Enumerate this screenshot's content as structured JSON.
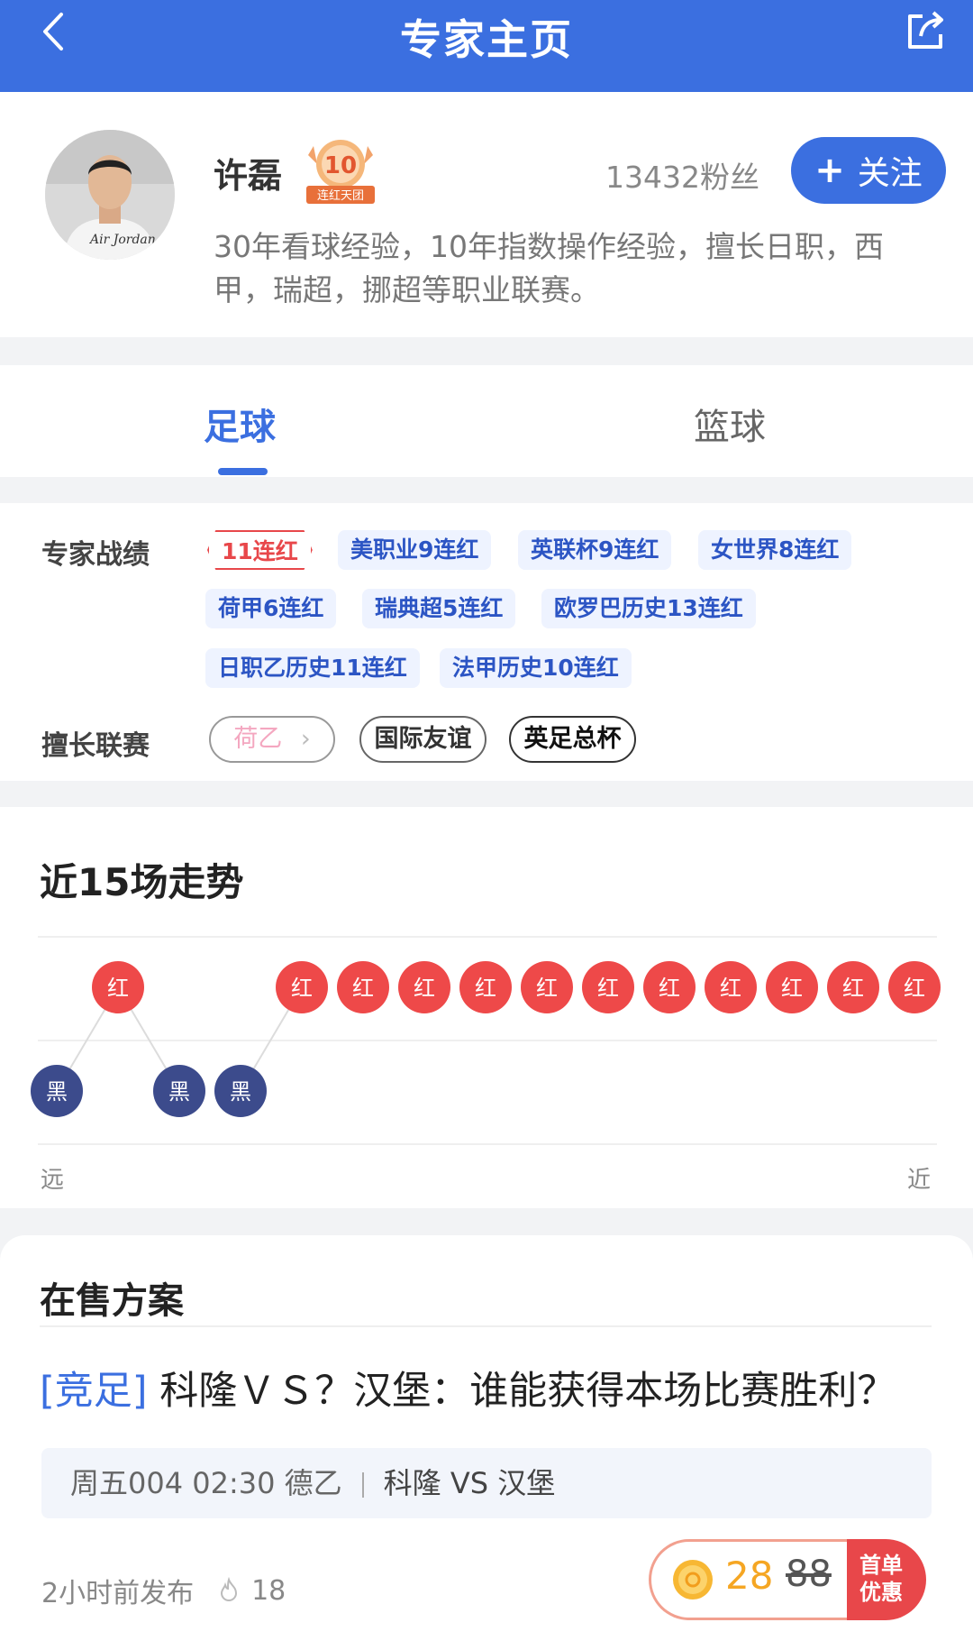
{
  "header": {
    "title": "专家主页"
  },
  "profile": {
    "name": "许磊",
    "badge_number": "10",
    "badge_text": "连红天团",
    "fans": "13432粉丝",
    "follow_label": "关注",
    "bio": "30年看球经验，10年指数操作经验，擅长日职，西甲，瑞超，挪超等职业联赛。"
  },
  "tabs": {
    "active": "足球",
    "inactive": "篮球"
  },
  "record": {
    "label": "专家战绩",
    "highlight": "11连红",
    "tags": [
      "美职业9连红",
      "英联杯9连红",
      "女世界8连红",
      "荷甲6连红",
      "瑞典超5连红",
      "欧罗巴历史13连红",
      "日职乙历史11连红",
      "法甲历史10连红"
    ],
    "league_label": "擅长联赛",
    "leagues": [
      "荷乙",
      "国际友谊",
      "英足总杯"
    ]
  },
  "trend": {
    "title": "近15场走势",
    "results": [
      "黑",
      "红",
      "黑",
      "黑",
      "红",
      "红",
      "红",
      "红",
      "红",
      "红",
      "红",
      "红",
      "红",
      "红",
      "红"
    ],
    "far_label": "远",
    "near_label": "近",
    "colors": {
      "red": "#ee4949",
      "black": "#3c4b8c"
    }
  },
  "sale": {
    "title": "在售方案",
    "plan_category": "[竞足]",
    "plan_title": " 科隆ＶＳ？汉堡：谁能获得本场比赛胜利？",
    "match_info": "周五004 02:30 德乙",
    "match_teams": "科隆 VS 汉堡",
    "published": "2小时前发布",
    "views": "18",
    "price_now": "28",
    "price_old": "88",
    "promo_line1": "首单",
    "promo_line2": "优惠"
  }
}
